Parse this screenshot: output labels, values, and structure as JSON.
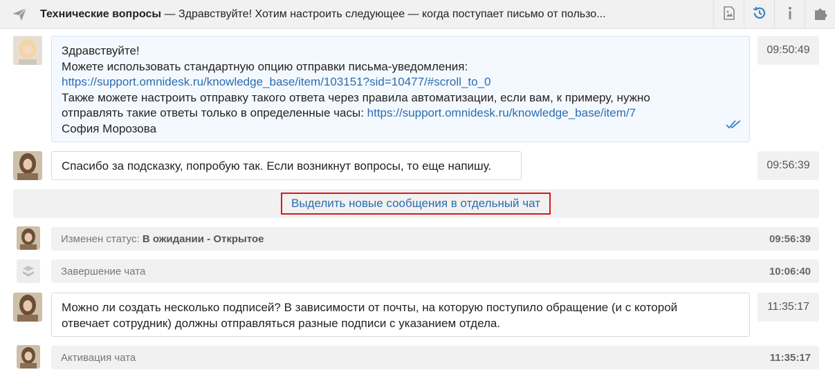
{
  "header": {
    "subject": "Технические вопросы",
    "preview": " — Здравствуйте! Хотим настроить следующее — когда поступает письмо от пользо...",
    "tools": [
      "attachments-icon",
      "history-icon",
      "info-icon",
      "apps-icon"
    ]
  },
  "messages": [
    {
      "lines": [
        "Здравствуйте!",
        "Можете использовать стандартную опцию отправки письма-уведомления:",
        "https://support.omnidesk.ru/knowledge_base/item/103151?sid=10477/#scroll_to_0",
        "Также можете настроить отправку такого ответа через правила автоматизации, если вам, к примеру, нужно",
        "отправлять такие ответы только в определенные часы: ",
        "https://support.omnidesk.ru/knowledge_base/item/7",
        "София Морозова"
      ],
      "time": "09:50:49",
      "read_icon": "double-check-icon"
    },
    {
      "text": "Спасибо за подсказку, попробую так. Если возникнут вопросы, то еще напишу.",
      "time": "09:56:39"
    },
    {
      "lines": [
        "Можно ли создать несколько подписей? В зависимости от почты, на которую поступило обращение (и с которой",
        "отвечает сотрудник) должны отправляться разные подписи с указанием отдела."
      ],
      "time": "11:35:17"
    }
  ],
  "split_link": "Выделить новые сообщения в отдельный чат",
  "events": [
    {
      "label": "Изменен статус: ",
      "value": "В ожидании - Открытое",
      "time": "09:56:39"
    },
    {
      "label": "Завершение чата",
      "time": "10:06:40"
    },
    {
      "label": "Активация чата",
      "time": "11:35:17"
    }
  ],
  "colors": {
    "link": "#2b6cb0",
    "highlight_border": "#d81818",
    "agent_bubble": "#f4f9ff"
  }
}
